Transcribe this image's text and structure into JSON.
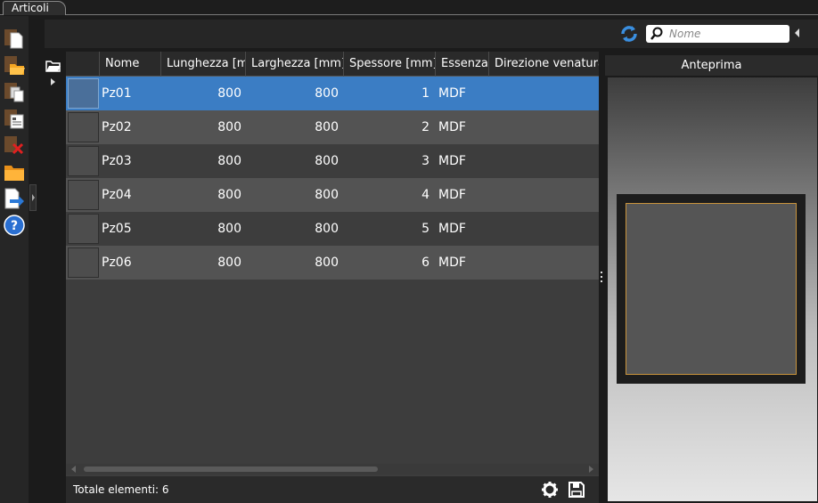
{
  "tab": {
    "label": "Articoli"
  },
  "toolbar": {
    "search_placeholder": "Nome"
  },
  "left_tools": [
    {
      "icon": "new-document-icon"
    },
    {
      "icon": "open-folder-icon"
    },
    {
      "icon": "copy-document-icon"
    },
    {
      "icon": "list-document-icon"
    },
    {
      "icon": "delete-document-icon"
    },
    {
      "icon": "folder-icon"
    },
    {
      "icon": "export-icon"
    },
    {
      "icon": "help-icon"
    }
  ],
  "grid": {
    "columns": [
      "Nome",
      "Lunghezza [m",
      "Larghezza [mm]",
      "Spessore [mm]",
      "Essenza",
      "Direzione venatura"
    ],
    "rows": [
      {
        "nome": "Pz01",
        "lunghezza": "800",
        "larghezza": "800",
        "spessore": "1",
        "essenza": "MDF",
        "direzione": ""
      },
      {
        "nome": "Pz02",
        "lunghezza": "800",
        "larghezza": "800",
        "spessore": "2",
        "essenza": "MDF",
        "direzione": ""
      },
      {
        "nome": "Pz03",
        "lunghezza": "800",
        "larghezza": "800",
        "spessore": "3",
        "essenza": "MDF",
        "direzione": ""
      },
      {
        "nome": "Pz04",
        "lunghezza": "800",
        "larghezza": "800",
        "spessore": "4",
        "essenza": "MDF",
        "direzione": ""
      },
      {
        "nome": "Pz05",
        "lunghezza": "800",
        "larghezza": "800",
        "spessore": "5",
        "essenza": "MDF",
        "direzione": ""
      },
      {
        "nome": "Pz06",
        "lunghezza": "800",
        "larghezza": "800",
        "spessore": "6",
        "essenza": "MDF",
        "direzione": ""
      }
    ],
    "selected_index": 0,
    "total_label": "Totale elementi: 6"
  },
  "preview": {
    "title": "Anteprima"
  },
  "colors": {
    "selection": "#3b7dc4",
    "panel_edge": "#c9943c"
  }
}
